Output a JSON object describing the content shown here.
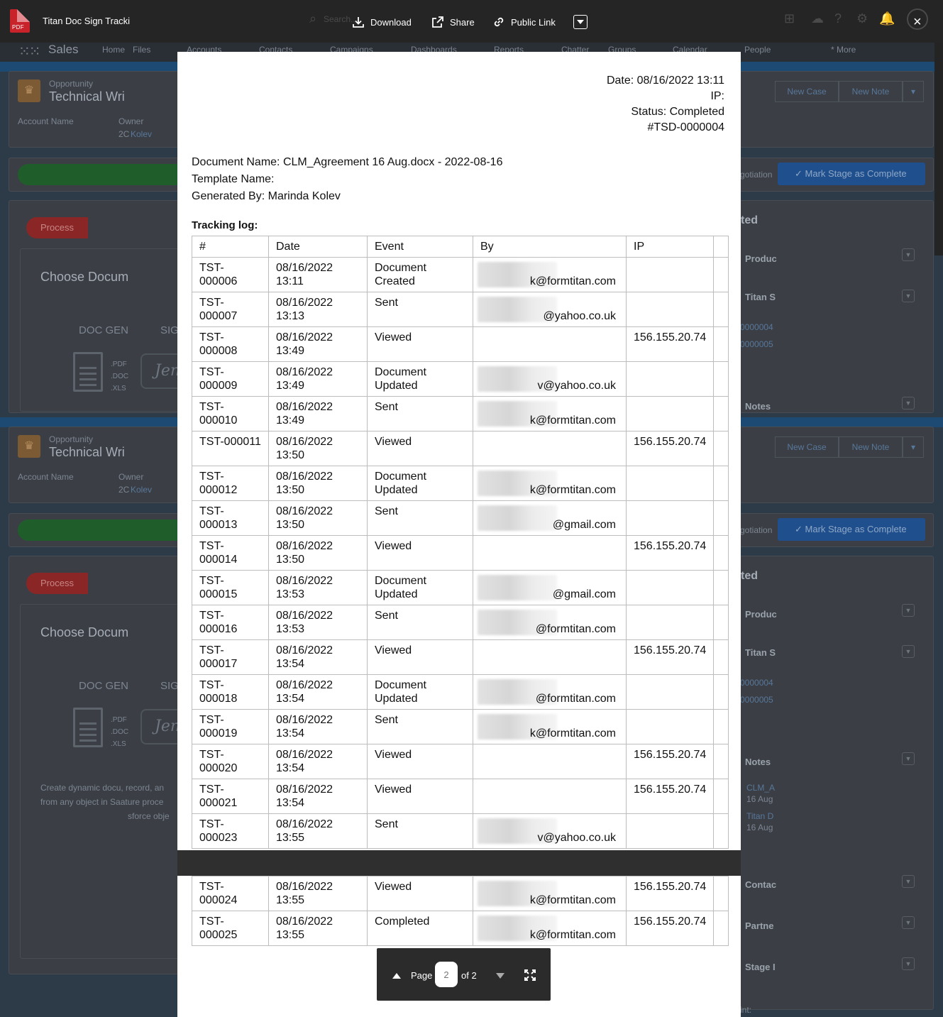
{
  "viewer": {
    "file_title": "Titan Doc Sign Tracki",
    "pdf_badge": "PDF",
    "actions": {
      "download": "Download",
      "share": "Share",
      "public_link": "Public Link"
    },
    "search_placeholder": "Search...",
    "close": "×"
  },
  "background": {
    "app_name": "Sales",
    "nav_tabs": [
      "Home",
      "Files",
      "Accounts",
      "Contacts",
      "Campaigns",
      "Dashboards",
      "Reports",
      "Chatter",
      "Groups",
      "Calendar",
      "People",
      "* More"
    ],
    "record_type": "Opportunity",
    "record_title": "Technical Wri",
    "account_name_label": "Account Name",
    "owner_label": "Owner",
    "owner_value": "Kolev",
    "owner_prefix": "2C",
    "new_case": "New Case",
    "new_note": "New Note",
    "negotiation": "gotiation",
    "mark_complete": "Mark Stage as Complete",
    "process_chip": "Process",
    "choose_doc": "Choose Docum",
    "doc_gen": "DOC GEN",
    "sig": "SIG",
    "file_exts": [
      ".PDF",
      ".DOC",
      ".XLS"
    ],
    "related_header": "ted",
    "related_items": [
      "Produc",
      "Titan S",
      "Notes",
      "Contac",
      "Partne",
      "Stage I"
    ],
    "related_links": [
      "0000004",
      "0000005"
    ],
    "notes_items": [
      "CLM_A",
      "16 Aug",
      "Titan D",
      "16 Aug"
    ],
    "description": [
      "Create dynamic docu, record, an",
      "from any object in Saature proce",
      "sforce obje"
    ],
    "footer_text": "int:"
  },
  "document": {
    "header": {
      "date": "Date: 08/16/2022 13:11",
      "ip": "IP:",
      "status": "Status: Completed",
      "number": "#TSD-0000004"
    },
    "document_name": "Document Name: CLM_Agreement 16 Aug.docx - 2022-08-16",
    "template_name": "Template Name:",
    "generated_by": "Generated By: Marinda Kolev",
    "tracking_label": "Tracking log:",
    "columns": [
      "#",
      "Date",
      "Event",
      "By",
      "IP"
    ],
    "rows_page1": [
      {
        "id": "TST-000006",
        "date": "08/16/2022",
        "time": "13:11",
        "event": "Document",
        "event2": "Created",
        "by": "k@formtitan.com",
        "ip": ""
      },
      {
        "id": "TST-000007",
        "date": "08/16/2022",
        "time": "13:13",
        "event": "Sent",
        "event2": "",
        "by": "@yahoo.co.uk",
        "ip": ""
      },
      {
        "id": "TST-000008",
        "date": "08/16/2022",
        "time": "13:49",
        "event": "Viewed",
        "event2": "",
        "by": "",
        "ip": "156.155.20.74"
      },
      {
        "id": "TST-000009",
        "date": "08/16/2022",
        "time": "13:49",
        "event": "Document",
        "event2": "Updated",
        "by": "v@yahoo.co.uk",
        "ip": ""
      },
      {
        "id": "TST-000010",
        "date": "08/16/2022",
        "time": "13:49",
        "event": "Sent",
        "event2": "",
        "by": "k@formtitan.com",
        "ip": ""
      },
      {
        "id": "TST-000011",
        "date": "08/16/2022",
        "time": "13:50",
        "event": "Viewed",
        "event2": "",
        "by": "",
        "ip": "156.155.20.74"
      },
      {
        "id": "TST-000012",
        "date": "08/16/2022",
        "time": "13:50",
        "event": "Document",
        "event2": "Updated",
        "by": "k@formtitan.com",
        "ip": ""
      },
      {
        "id": "TST-000013",
        "date": "08/16/2022",
        "time": "13:50",
        "event": "Sent",
        "event2": "",
        "by": "@gmail.com",
        "ip": ""
      },
      {
        "id": "TST-000014",
        "date": "08/16/2022",
        "time": "13:50",
        "event": "Viewed",
        "event2": "",
        "by": "",
        "ip": "156.155.20.74"
      },
      {
        "id": "TST-000015",
        "date": "08/16/2022",
        "time": "13:53",
        "event": "Document",
        "event2": "Updated",
        "by": "@gmail.com",
        "ip": ""
      },
      {
        "id": "TST-000016",
        "date": "08/16/2022",
        "time": "13:53",
        "event": "Sent",
        "event2": "",
        "by": "@formtitan.com",
        "ip": ""
      },
      {
        "id": "TST-000017",
        "date": "08/16/2022",
        "time": "13:54",
        "event": "Viewed",
        "event2": "",
        "by": "",
        "ip": "156.155.20.74"
      },
      {
        "id": "TST-000018",
        "date": "08/16/2022",
        "time": "13:54",
        "event": "Document",
        "event2": "Updated",
        "by": "@formtitan.com",
        "ip": ""
      },
      {
        "id": "TST-000019",
        "date": "08/16/2022",
        "time": "13:54",
        "event": "Sent",
        "event2": "",
        "by": "k@formtitan.com",
        "ip": ""
      },
      {
        "id": "TST-000020",
        "date": "08/16/2022",
        "time": "13:54",
        "event": "Viewed",
        "event2": "",
        "by": "",
        "ip": "156.155.20.74"
      },
      {
        "id": "TST-000021",
        "date": "08/16/2022",
        "time": "13:54",
        "event": "Viewed",
        "event2": "",
        "by": "",
        "ip": "156.155.20.74"
      },
      {
        "id": "TST-000023",
        "date": "08/16/2022",
        "time": "13:55",
        "event": "Sent",
        "event2": "",
        "by": "v@yahoo.co.uk",
        "ip": ""
      }
    ],
    "rows_page2": [
      {
        "id": "TST-000024",
        "date": "08/16/2022",
        "time": "13:55",
        "event": "Viewed",
        "event2": "",
        "by": "k@formtitan.com",
        "ip": "156.155.20.74"
      },
      {
        "id": "TST-000025",
        "date": "08/16/2022",
        "time": "13:55",
        "event": "Completed",
        "event2": "",
        "by": "k@formtitan.com",
        "ip": "156.155.20.74"
      }
    ]
  },
  "pager": {
    "label": "Page",
    "current": "2",
    "of": "of 2"
  },
  "colors": {
    "pdf_red": "#c8232b",
    "toolbar": "#252525",
    "mark_complete_blue": "#1f4f8c"
  }
}
